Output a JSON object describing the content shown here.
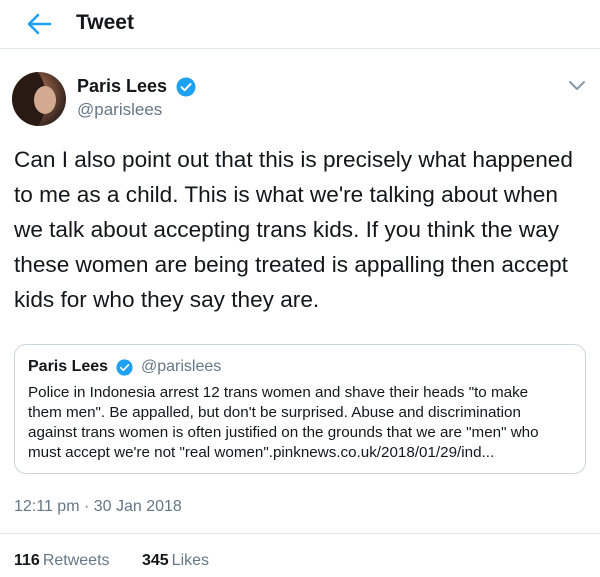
{
  "header": {
    "title": "Tweet",
    "back_icon": "back-arrow-icon"
  },
  "author": {
    "name": "Paris Lees",
    "handle": "@parislees",
    "verified": true
  },
  "tweet": {
    "text": "Can I also point out that this is precisely what happened\nto me as a child. This is what we're talking about when\nwe talk about accepting trans kids. If you think the way\nthese women are being treated is appalling then accept\nkids for who they say they are."
  },
  "quote": {
    "name": "Paris Lees",
    "handle": "@parislees",
    "text": "Police in Indonesia arrest 12 trans women and shave their heads \"to make\nthem men\". Be appalled, but don't be surprised. Abuse and discrimination\nagainst trans women is often justified on the grounds that we are \"men\" who\nmust accept we're not \"real women\".pinknews.co.uk/2018/01/29/ind..."
  },
  "timestamp": "12:11 pm · 30 Jan 2018",
  "stats": {
    "retweets_count": "116",
    "retweets_label": "Retweets",
    "likes_count": "345",
    "likes_label": "Likes"
  },
  "colors": {
    "accent": "#1da1f2",
    "secondary_text": "#657786",
    "border": "#e1e8ed"
  }
}
